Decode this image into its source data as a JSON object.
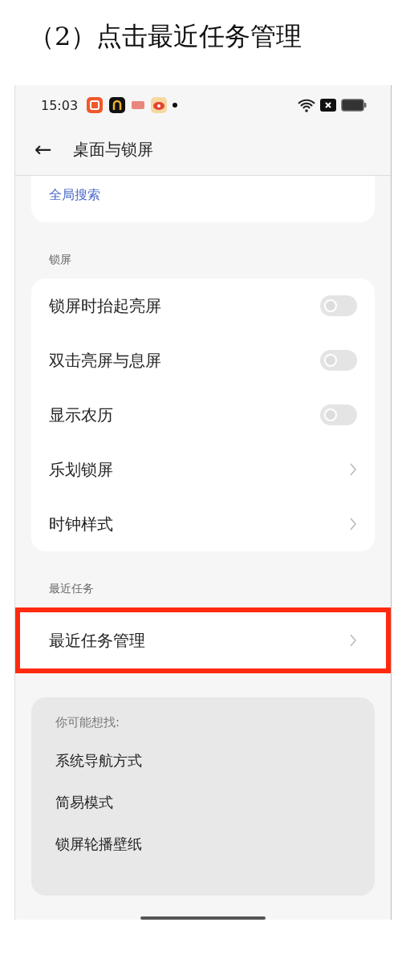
{
  "caption": "（2）点击最近任务管理",
  "status_bar": {
    "time": "15:03"
  },
  "header": {
    "back": "←",
    "title": "桌面与锁屏"
  },
  "top_card": {
    "subtitle": "全局搜索"
  },
  "sections": [
    {
      "label": "锁屏",
      "rows": [
        {
          "kind": "toggle",
          "label": "锁屏时抬起亮屏",
          "on": false
        },
        {
          "kind": "toggle",
          "label": "双击亮屏与息屏",
          "on": false
        },
        {
          "kind": "toggle",
          "label": "显示农历",
          "on": false
        },
        {
          "kind": "link",
          "label": "乐划锁屏"
        },
        {
          "kind": "link",
          "label": "时钟样式"
        }
      ]
    },
    {
      "label": "最近任务",
      "rows": [
        {
          "kind": "link",
          "label": "最近任务管理",
          "highlighted": true
        }
      ]
    }
  ],
  "suggestions": {
    "title": "你可能想找:",
    "items": [
      "系统导航方式",
      "简易模式",
      "锁屏轮播壁纸"
    ]
  }
}
